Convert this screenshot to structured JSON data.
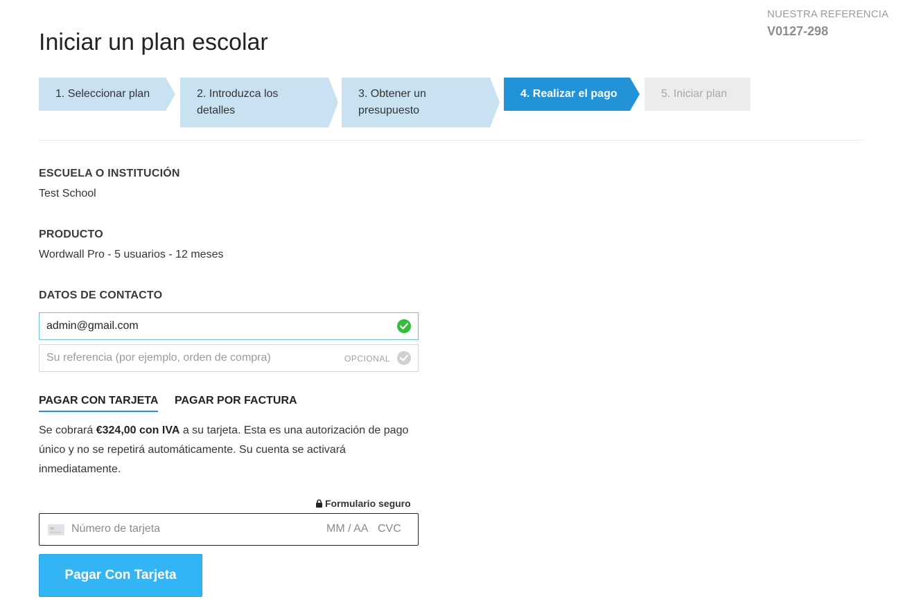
{
  "reference": {
    "label": "NUESTRA REFERENCIA",
    "value": "V0127-298"
  },
  "page_title": "Iniciar un plan escolar",
  "steps": [
    {
      "label": "1. Seleccionar plan",
      "state": "done"
    },
    {
      "label": "2. Introduzca los detalles",
      "state": "done"
    },
    {
      "label": "3. Obtener un presupuesto",
      "state": "done"
    },
    {
      "label": "4. Realizar el pago",
      "state": "active"
    },
    {
      "label": "5. Iniciar plan",
      "state": "pending"
    }
  ],
  "school": {
    "label": "ESCUELA O INSTITUCIÓN",
    "value": "Test School"
  },
  "product": {
    "label": "PRODUCTO",
    "value": "Wordwall Pro - 5 usuarios - 12 meses"
  },
  "contact": {
    "label": "DATOS DE CONTACTO",
    "email_value": "admin@gmail.com",
    "reference_placeholder": "Su referencia (por ejemplo, orden de compra)",
    "optional_label": "OPCIONAL"
  },
  "payment_tabs": [
    {
      "label": "PAGAR CON TARJETA",
      "active": true
    },
    {
      "label": "PAGAR POR FACTURA",
      "active": false
    }
  ],
  "description": {
    "prefix": "Se cobrará ",
    "amount": "€324,00 con IVA",
    "suffix": " a su tarjeta. Esta es una autorización de pago único y no se repetirá automáticamente. Su cuenta se activará inmediatamente."
  },
  "secure_form_label": "Formulario seguro",
  "card_input": {
    "number_placeholder": "Número de tarjeta",
    "expiry_placeholder": "MM / AA",
    "cvc_placeholder": "CVC"
  },
  "pay_button_label": "Pagar Con Tarjeta",
  "colors": {
    "step_done": "#c9e2f2",
    "step_active": "#2293d6",
    "step_pending": "#ececec",
    "button": "#33b5f5",
    "valid_check": "#2fbf3a"
  },
  "icons": [
    "check-icon",
    "lock-icon",
    "credit-card-icon"
  ]
}
